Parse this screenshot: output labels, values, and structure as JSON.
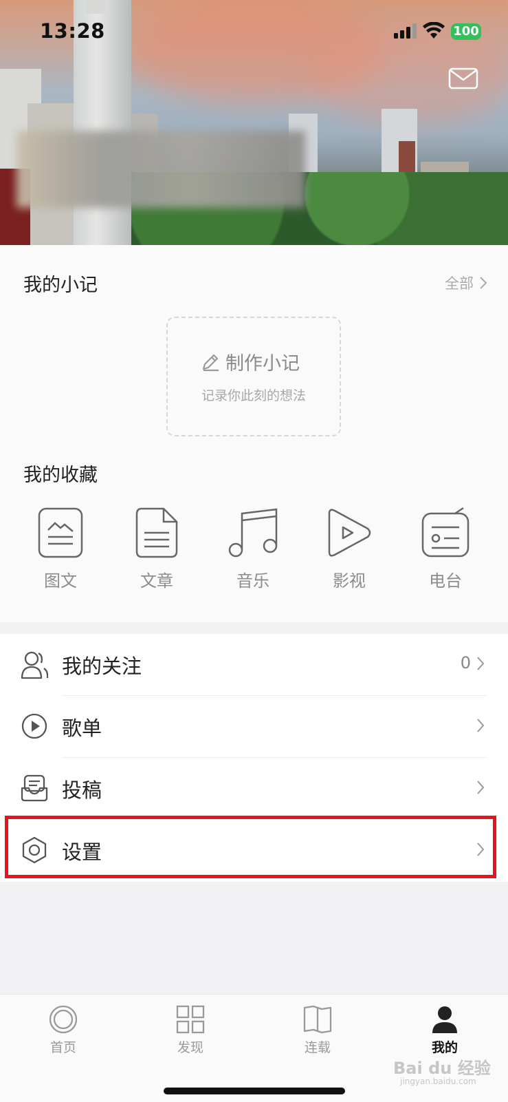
{
  "status_bar": {
    "time": "13:28",
    "battery": "100"
  },
  "notes": {
    "title": "我的小记",
    "all_label": "全部",
    "make_title": "制作小记",
    "make_subtitle": "记录你此刻的想法"
  },
  "favorites": {
    "title": "我的收藏",
    "items": [
      {
        "label": "图文",
        "icon": "image-text-icon"
      },
      {
        "label": "文章",
        "icon": "article-icon"
      },
      {
        "label": "音乐",
        "icon": "music-icon"
      },
      {
        "label": "影视",
        "icon": "video-icon"
      },
      {
        "label": "电台",
        "icon": "radio-icon"
      }
    ]
  },
  "menu": {
    "items": [
      {
        "label": "我的关注",
        "count": "0",
        "icon": "follow-icon"
      },
      {
        "label": "歌单",
        "icon": "playlist-icon"
      },
      {
        "label": "投稿",
        "icon": "submit-icon"
      },
      {
        "label": "设置",
        "icon": "settings-icon"
      }
    ]
  },
  "tabbar": {
    "items": [
      {
        "label": "首页",
        "icon": "home-icon"
      },
      {
        "label": "发现",
        "icon": "discover-icon"
      },
      {
        "label": "连载",
        "icon": "serial-icon"
      },
      {
        "label": "我的",
        "icon": "profile-icon",
        "active": true
      }
    ]
  },
  "watermark": {
    "text": "Bai du 经验",
    "sub": "jingyan.baidu.com"
  },
  "colors": {
    "highlight": "#e8141c",
    "battery": "#32c05a"
  }
}
